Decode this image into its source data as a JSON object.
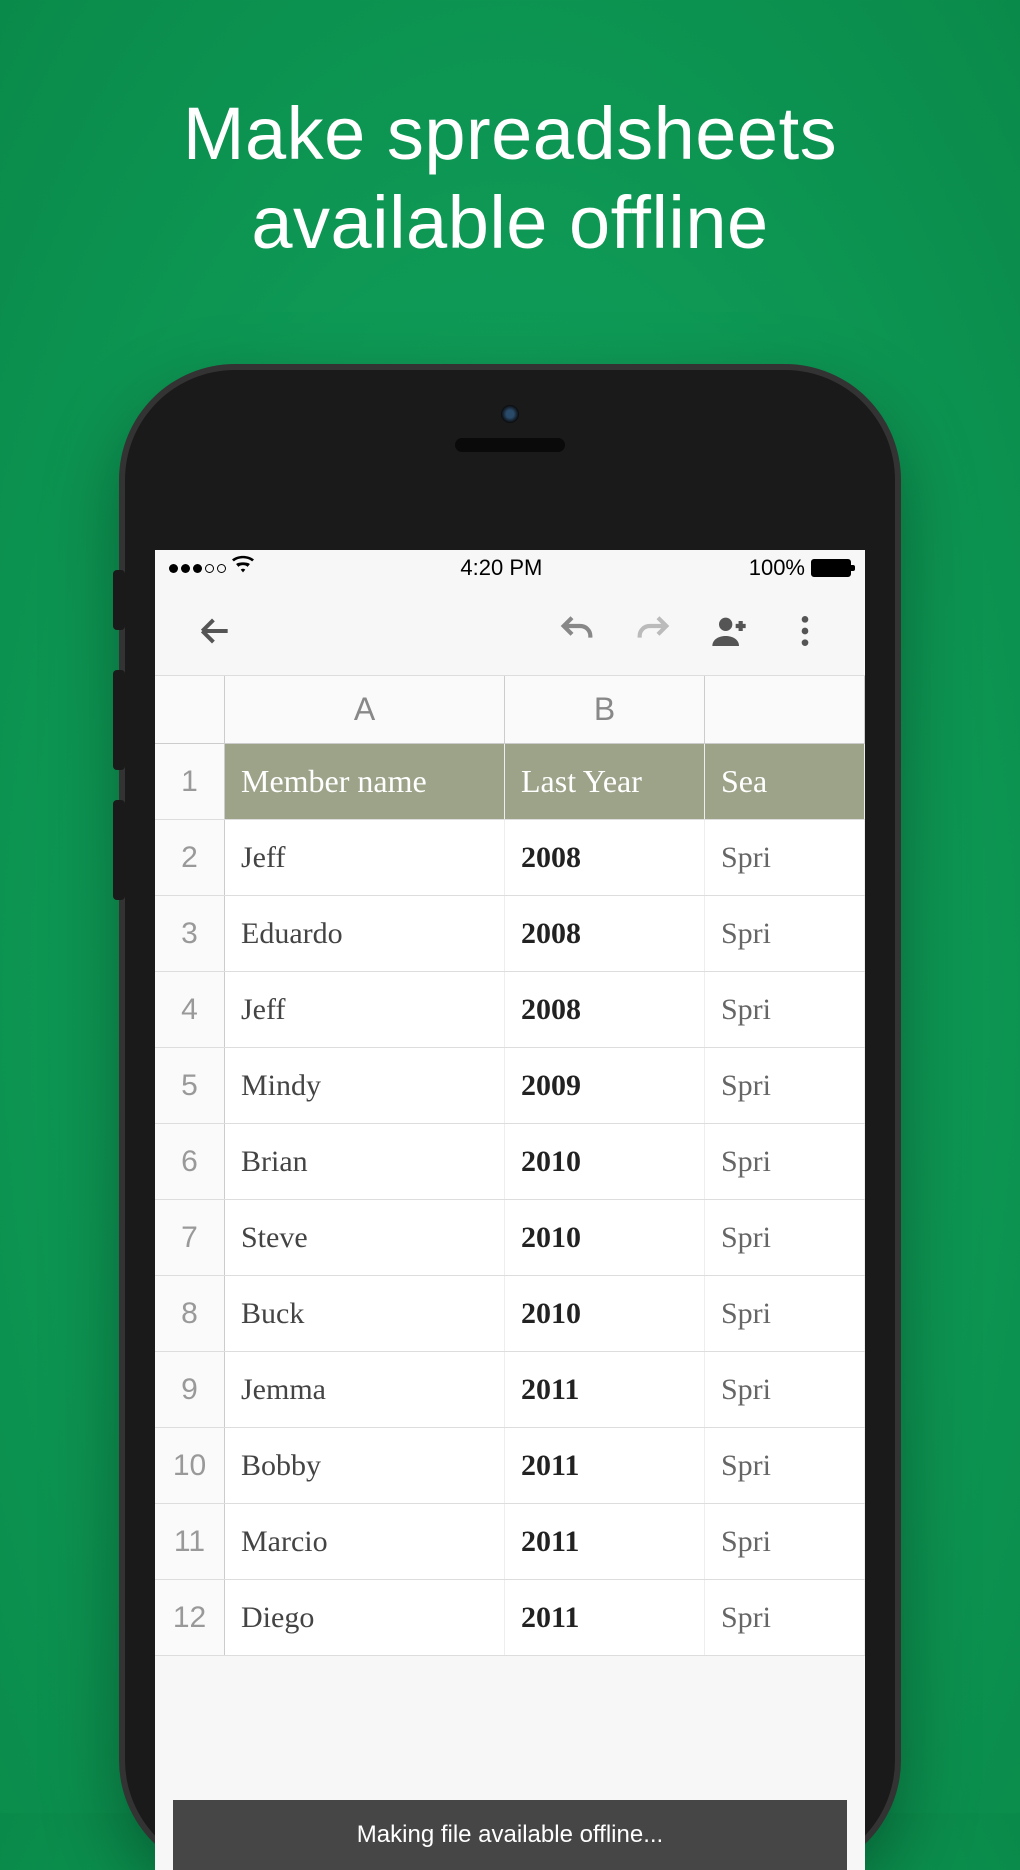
{
  "headline_line1": "Make spreadsheets",
  "headline_line2": "available offline",
  "status": {
    "time": "4:20 PM",
    "battery_pct": "100%"
  },
  "columns": [
    "A",
    "B"
  ],
  "header_row": {
    "num": "1",
    "a": "Member name",
    "b": "Last Year",
    "c": "Sea"
  },
  "rows": [
    {
      "num": "2",
      "a": "Jeff",
      "b": "2008",
      "c": "Spri"
    },
    {
      "num": "3",
      "a": "Eduardo",
      "b": "2008",
      "c": "Spri"
    },
    {
      "num": "4",
      "a": "Jeff",
      "b": "2008",
      "c": "Spri"
    },
    {
      "num": "5",
      "a": "Mindy",
      "b": "2009",
      "c": "Spri"
    },
    {
      "num": "6",
      "a": "Brian",
      "b": "2010",
      "c": "Spri"
    },
    {
      "num": "7",
      "a": "Steve",
      "b": "2010",
      "c": "Spri"
    },
    {
      "num": "8",
      "a": "Buck",
      "b": "2010",
      "c": "Spri"
    },
    {
      "num": "9",
      "a": "Jemma",
      "b": "2011",
      "c": "Spri"
    },
    {
      "num": "10",
      "a": "Bobby",
      "b": "2011",
      "c": "Spri"
    },
    {
      "num": "11",
      "a": "Marcio",
      "b": "2011",
      "c": "Spri"
    },
    {
      "num": "12",
      "a": "Diego",
      "b": "2011",
      "c": "Spri"
    }
  ],
  "toast": "Making file available offline..."
}
